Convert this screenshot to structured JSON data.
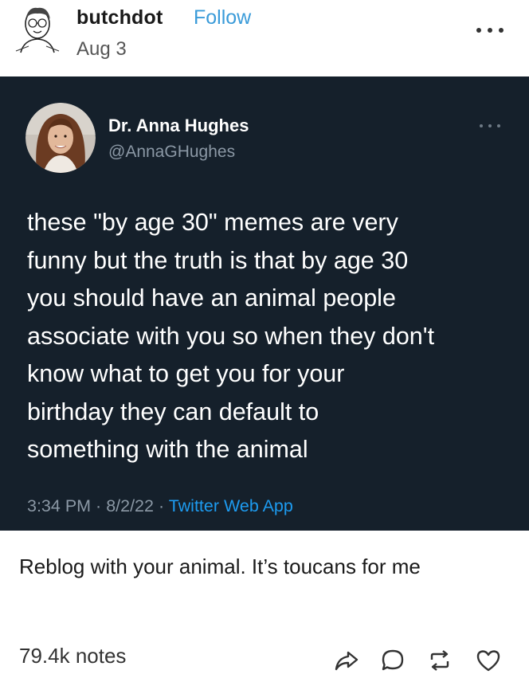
{
  "post": {
    "blog_name": "butchdot",
    "follow_label": "Follow",
    "date": "Aug 3",
    "menu_icon": "more-horizontal-icon"
  },
  "tweet": {
    "display_name": "Dr. Anna Hughes",
    "handle": "@AnnaGHughes",
    "text": "these \"by age 30\" memes are very\nfunny but the truth is that by age 30\nyou should have an animal people\nassociate with you so when they don't\nknow what to get you for your\nbirthday they can default to\nsomething with the animal",
    "time": "3:34 PM",
    "separator1": " · ",
    "date": "8/2/22",
    "separator2": " · ",
    "source": "Twitter Web App",
    "background": "#15202b",
    "link_color": "#1d9bf0"
  },
  "caption": "Reblog with your animal. It’s toucans for me",
  "footer": {
    "notes": "79.4k notes",
    "actions": [
      "share-icon",
      "reply-icon",
      "reblog-icon",
      "like-icon"
    ]
  }
}
